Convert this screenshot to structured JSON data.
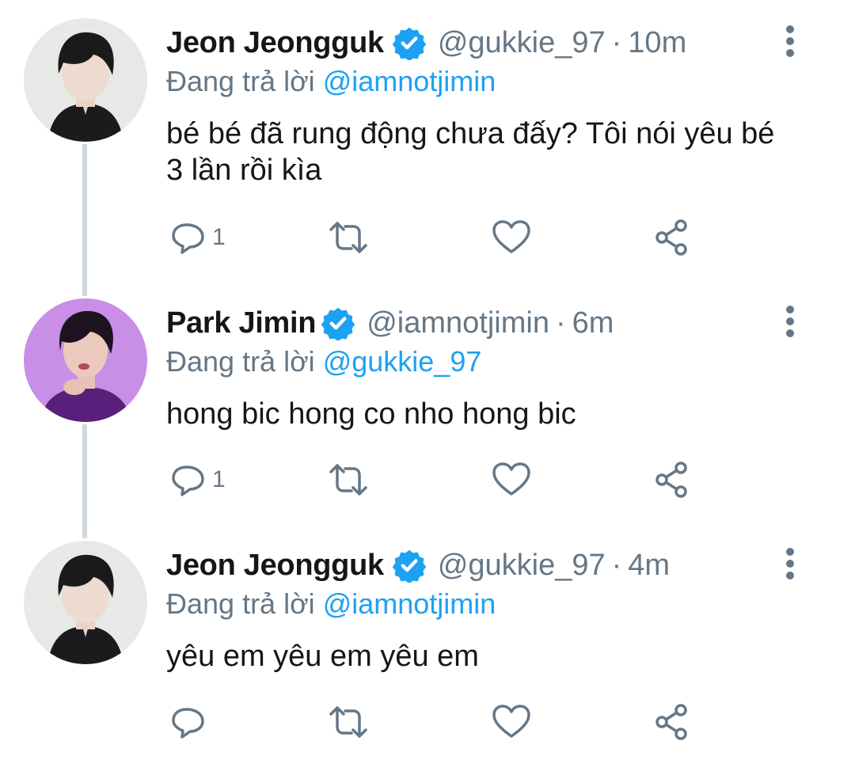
{
  "tweets": [
    {
      "name": "Jeon Jeongguk",
      "handle": "@gukkie_97",
      "separator": "·",
      "time": "10m",
      "replying_prefix": "Đang trả lời",
      "replying_to": "@iamnotjimin",
      "text": "bé bé đã rung động chưa đấy? Tôi nói yêu bé 3 lần rồi kìa",
      "reply_count": "1",
      "avatar": "jeongguk-avatar"
    },
    {
      "name": "Park Jimin",
      "handle": "@iamnotjimin",
      "separator": "·",
      "time": "6m",
      "replying_prefix": "Đang trả lời",
      "replying_to": "@gukkie_97",
      "text": "hong bic hong co nho hong bic",
      "reply_count": "1",
      "avatar": "jimin-avatar"
    },
    {
      "name": "Jeon Jeongguk",
      "handle": "@gukkie_97",
      "separator": "·",
      "time": "4m",
      "replying_prefix": "Đang trả lời",
      "replying_to": "@iamnotjimin",
      "text": "yêu em yêu em yêu em",
      "reply_count": "",
      "avatar": "jeongguk-avatar"
    }
  ],
  "icons": {
    "verified": "verified-badge-icon",
    "more": "more-vertical-icon",
    "reply": "reply-bubble-icon",
    "retweet": "retweet-icon",
    "like": "heart-icon",
    "share": "share-icon"
  },
  "colors": {
    "accent": "#1da1f2",
    "secondary_text": "#657786",
    "thread_line": "#cfd9de",
    "jimin_avatar_bg": "#c98ee6"
  }
}
